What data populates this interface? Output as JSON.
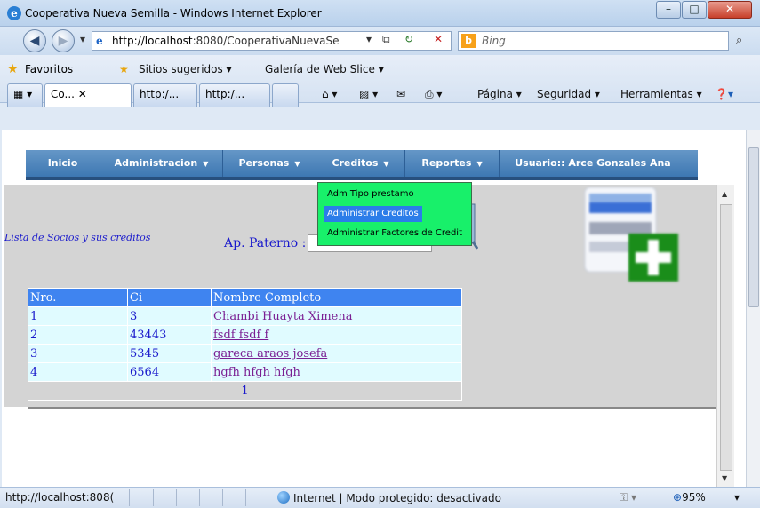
{
  "window": {
    "title": "Cooperativa Nueva Semilla - Windows Internet Explorer"
  },
  "address": {
    "url_host": "http://localhost",
    "url_rest": ":8080/CooperativaNuevaSe",
    "search_placeholder": "Bing"
  },
  "favbar": {
    "favorites": "Favoritos",
    "suggested": "Sitios sugeridos",
    "slice": "Galería de Web Slice",
    "tabs": [
      "Co...",
      "http:/...",
      "http:/..."
    ],
    "commands": {
      "page": "Página",
      "security": "Seguridad",
      "tools": "Herramientas"
    }
  },
  "menu": {
    "items": [
      "Inicio",
      "Administracion",
      "Personas",
      "Creditos",
      "Reportes",
      "Usuario:: Arce Gonzales Ana"
    ]
  },
  "dropdown": {
    "items": [
      "Adm Tipo prestamo",
      "Administrar Creditos",
      "Administrar Factores de Credit"
    ],
    "active_index": 1
  },
  "page": {
    "list_title": "Lista de Socios y sus creditos",
    "ap_paterno_label": "Ap. Paterno :"
  },
  "table": {
    "headers": [
      "Nro.",
      "Ci",
      "Nombre Completo"
    ],
    "rows": [
      {
        "nro": "1",
        "ci": "3",
        "name": "Chambi Huayta Ximena"
      },
      {
        "nro": "2",
        "ci": "43443",
        "name": "fsdf fsdf f"
      },
      {
        "nro": "3",
        "ci": "5345",
        "name": "gareca araos josefa"
      },
      {
        "nro": "4",
        "ci": "6564",
        "name": "hgfh hfgh hfgh"
      }
    ],
    "pager": "1"
  },
  "status": {
    "url": "http://localhost:808(",
    "zone": "Internet | Modo protegido: desactivado",
    "zoom": "95%"
  }
}
